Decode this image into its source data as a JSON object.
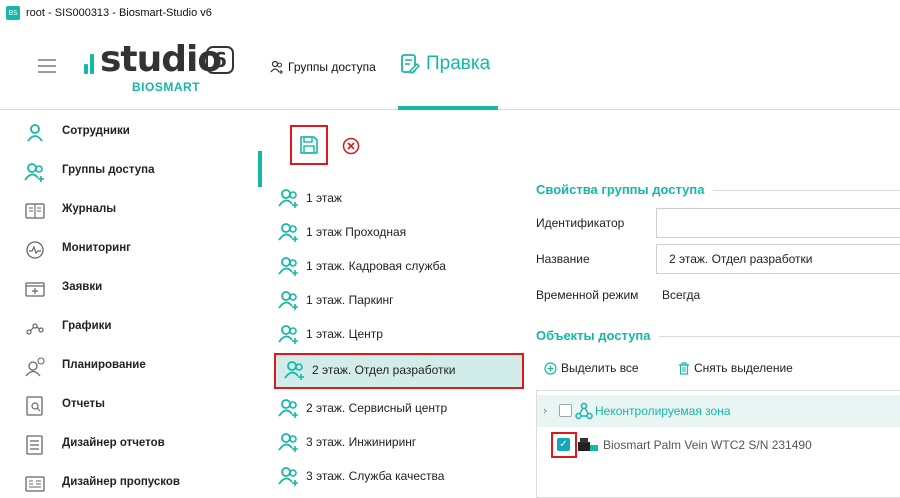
{
  "window": {
    "title": "root - SIS000313 - Biosmart-Studio v6",
    "app_icon_text": "BS"
  },
  "logo": {
    "word": "studio",
    "version": "6",
    "sub": "BIOSMART"
  },
  "header": {
    "nav_groups_label": "Группы доступа",
    "nav_edit_label": "Правка",
    "accent_color": "#14b8a6"
  },
  "sidebar": {
    "items": [
      {
        "label": "Сотрудники",
        "icon": "person-icon"
      },
      {
        "label": "Группы доступа",
        "icon": "group-icon",
        "active": true
      },
      {
        "label": "Журналы",
        "icon": "journal-icon"
      },
      {
        "label": "Мониторинг",
        "icon": "monitoring-icon"
      },
      {
        "label": "Заявки",
        "icon": "requests-icon"
      },
      {
        "label": "Графики",
        "icon": "schedule-icon"
      },
      {
        "label": "Планирование",
        "icon": "planning-icon"
      },
      {
        "label": "Отчеты",
        "icon": "reports-icon"
      },
      {
        "label": "Дизайнер отчетов",
        "icon": "report-designer-icon"
      },
      {
        "label": "Дизайнер пропусков",
        "icon": "pass-designer-icon"
      }
    ]
  },
  "toolbar": {
    "save_icon": "save-icon",
    "cancel_icon": "cancel-icon"
  },
  "groups": {
    "items": [
      {
        "label": "1 этаж"
      },
      {
        "label": "1 этаж Проходная"
      },
      {
        "label": "1 этаж. Кадровая служба"
      },
      {
        "label": "1 этаж. Паркинг"
      },
      {
        "label": "1 этаж. Центр"
      },
      {
        "label": "2 этаж. Отдел разработки",
        "selected": true
      },
      {
        "label": "2 этаж. Сервисный центр"
      },
      {
        "label": "3 этаж. Инжиниринг"
      },
      {
        "label": "3 этаж. Служба качества"
      }
    ]
  },
  "properties": {
    "section_title": "Свойства группы доступа",
    "identifier_label": "Идентификатор",
    "identifier_value": "",
    "name_label": "Название",
    "name_value": "2 этаж. Отдел разработки",
    "mode_label": "Временной режим",
    "mode_value": "Всегда"
  },
  "objects": {
    "section_title": "Объекты доступа",
    "select_all_label": "Выделить все",
    "deselect_label": "Снять выделение",
    "zone_label": "Неконтролируемая зона",
    "zone_checked": false,
    "device_label": "Biosmart Palm Vein WTC2 S/N 231490",
    "device_checked": true
  }
}
